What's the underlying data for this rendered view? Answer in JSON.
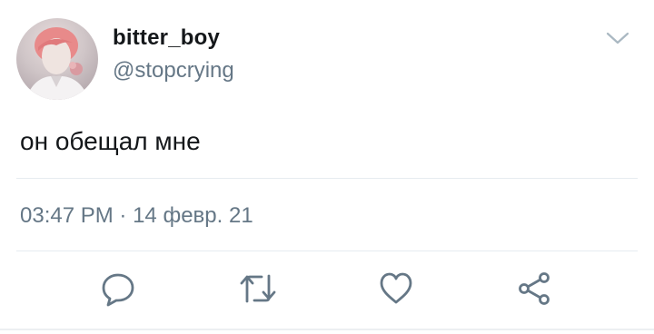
{
  "tweet": {
    "display_name": "bitter_boy",
    "handle": "@stopcrying",
    "text": "он обещал мне",
    "time": "03:47 PM",
    "separator": "·",
    "date": "14 февр. 21"
  },
  "icons": {
    "menu": "chevron-down-icon",
    "reply": "reply-icon",
    "retweet": "retweet-icon",
    "like": "heart-icon",
    "share": "share-icon"
  },
  "colors": {
    "text": "#14171a",
    "secondary": "#657786",
    "icon": "#657786",
    "divider": "#e6ecf0"
  }
}
